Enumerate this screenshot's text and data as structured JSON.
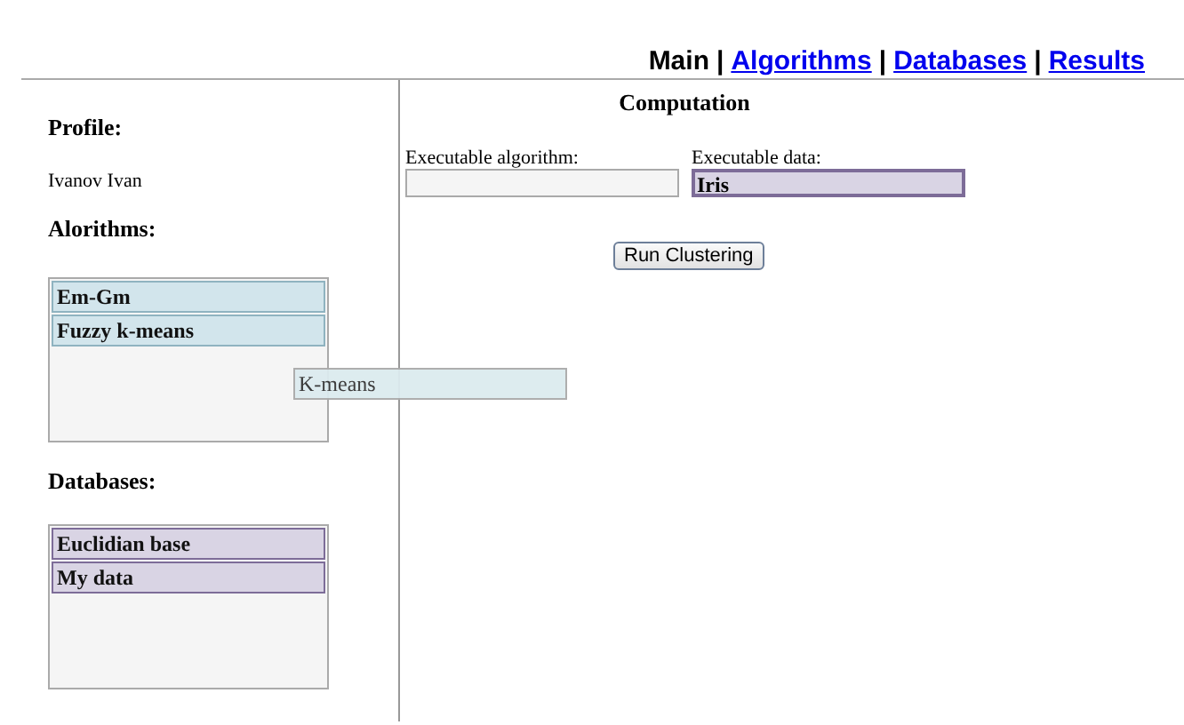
{
  "nav": [
    {
      "label": "Main",
      "selected": true
    },
    {
      "label": "Algorithms",
      "selected": false
    },
    {
      "label": "Databases",
      "selected": false
    },
    {
      "label": "Results",
      "selected": false
    }
  ],
  "nav_separator": "|",
  "profile": {
    "heading": "Profile:",
    "name": "Ivanov Ivan"
  },
  "algorithms": {
    "heading": "Alorithms:",
    "items": [
      {
        "label": "Em-Gm",
        "dragging": false
      },
      {
        "label": "Fuzzy k-means",
        "dragging": false
      },
      {
        "label": "K-means",
        "dragging": true
      }
    ]
  },
  "databases": {
    "heading": "Databases:",
    "items": [
      {
        "label": "Euclidian base",
        "dragging": false
      },
      {
        "label": "My data",
        "dragging": false
      }
    ]
  },
  "computation": {
    "title": "Computation",
    "fields": [
      {
        "label": "Executable algorithm:",
        "kind": "algorithm"
      },
      {
        "label": "Executable data:",
        "kind": "data",
        "value": "Iris"
      }
    ],
    "button": "Run Clustering"
  }
}
